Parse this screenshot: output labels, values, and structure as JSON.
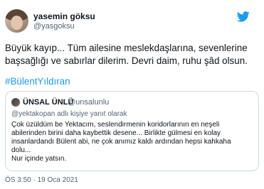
{
  "author": {
    "name": "yasemin göksu",
    "handle": "@yasgoksu",
    "avatar_icon": "user-avatar"
  },
  "tweet": {
    "lines": [
      "Büyük kayıp... Tüm ailesine meslekdaşlarına, sevenlerine",
      "başsağlığı ve sabırlar dilerim. Devri daim, ruhu şâd olsun."
    ],
    "hashtag": "#BülentYıldıran",
    "timestamp": "ÖS 3:50 · 19 Oca 2021"
  },
  "quoted": {
    "name": "ÜNSAL ÜNLÜ",
    "handle": "@unsalunlu",
    "reply_context": "@yektakopan adlı kişiye yanıt olarak",
    "lines": [
      "Çok üzüldüm be Yektacım, seslendirmenin koridorlarının en neşeli",
      "abilerinden birini daha kaybettik desene... Birlikte gülmesi en kolay",
      "insanlardandı Bülent abi, ne çok anımız kaldı ardından hepsi kahkaha",
      "dolu...",
      "Nur içinde yatsın."
    ]
  },
  "colors": {
    "link": "#1d9bf0",
    "text": "#0f1419",
    "muted": "#536471",
    "border": "#cfd9de"
  },
  "icons": {
    "brand": "twitter-bird-icon"
  }
}
